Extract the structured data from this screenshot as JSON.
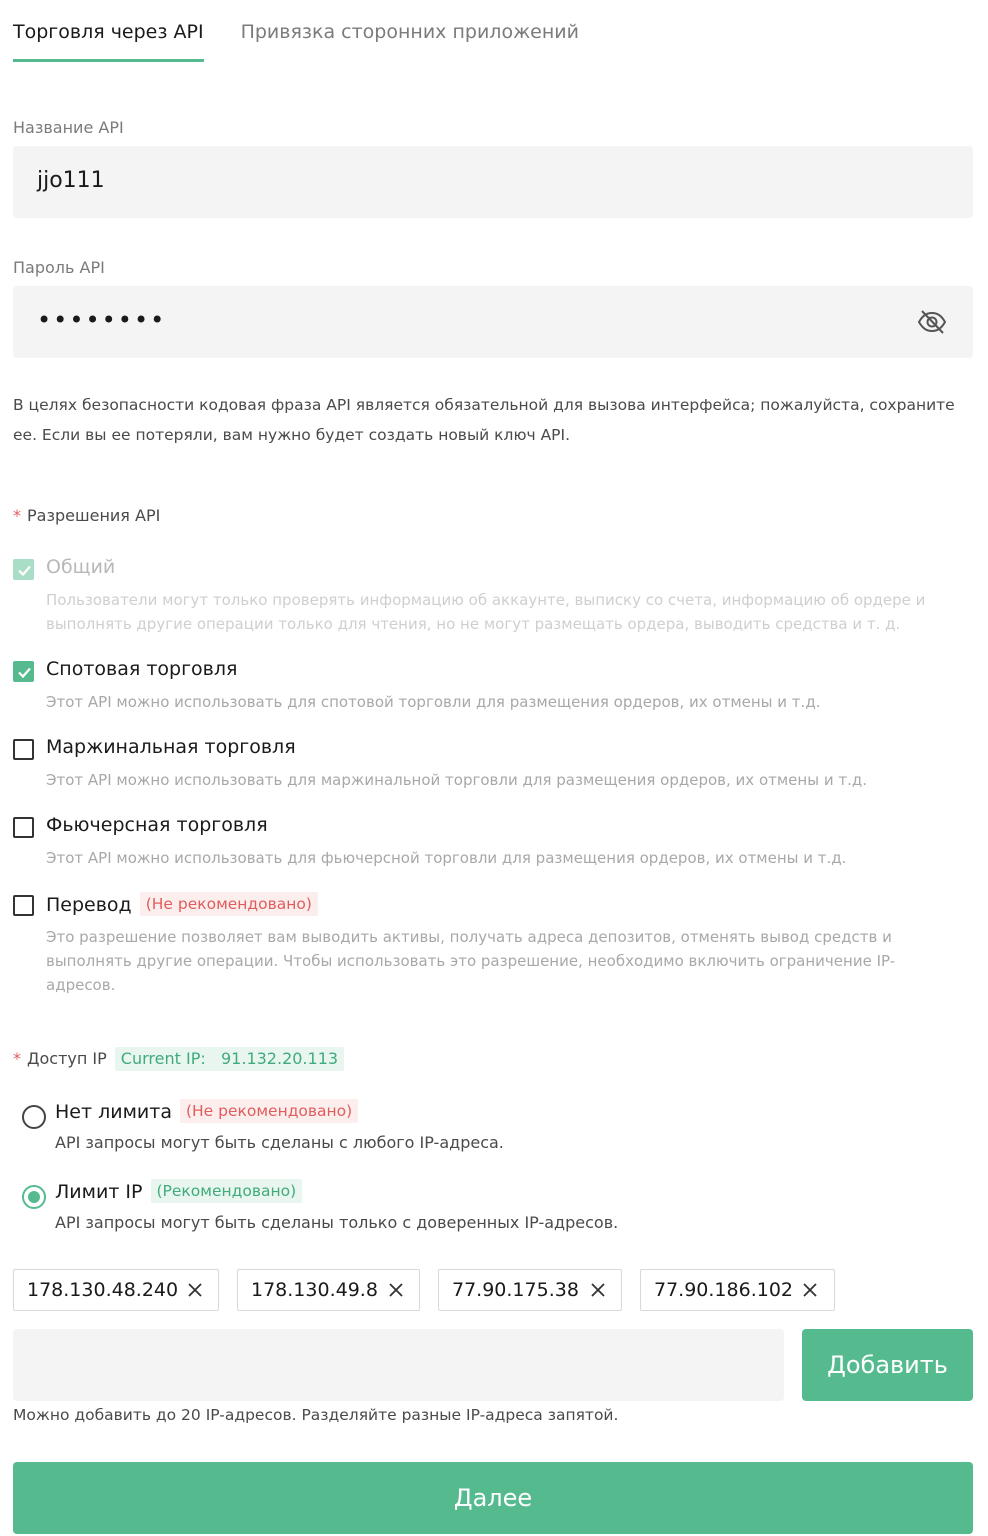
{
  "tabs": [
    {
      "label": "Торговля через API",
      "active": true
    },
    {
      "label": "Привязка сторонних приложений",
      "active": false
    }
  ],
  "api_name": {
    "label": "Название API",
    "value": "jjo111"
  },
  "api_password": {
    "label": "Пароль API",
    "masked_value": "••••••••",
    "toggle_icon": "eye-off-icon"
  },
  "security_note": "В целях безопасности кодовая фраза API является обязательной для вызова интерфейса; пожалуйста, сохраните ее. Если вы ее потеряли, вам нужно будет создать новый ключ API.",
  "permissions": {
    "required_mark": "*",
    "title": "Разрешения API",
    "items": [
      {
        "title": "Общий",
        "desc": "Пользователи могут только проверять информацию об аккаунте, выписку со счета, информацию об ордере и выполнять другие операции только для чтения, но не могут размещать ордера, выводить средства и т. д.",
        "checked": true,
        "disabled": true
      },
      {
        "title": "Спотовая торговля",
        "desc": "Этот API можно использовать для спотовой торговли для размещения ордеров, их отмены и т.д.",
        "checked": true,
        "disabled": false
      },
      {
        "title": "Маржинальная торговля",
        "desc": "Этот API можно использовать для маржинальной торговли для размещения ордеров, их отмены и т.д.",
        "checked": false,
        "disabled": false
      },
      {
        "title": "Фьючерсная торговля",
        "desc": "Этот API можно использовать для фьючерсной торговли для размещения ордеров, их отмены и т.д.",
        "checked": false,
        "disabled": false
      },
      {
        "title": "Перевод",
        "badge": "(Не рекомендовано)",
        "desc": "Это разрешение позволяет вам выводить активы, получать адреса депозитов, отменять вывод средств и выполнять другие операции. Чтобы использовать это разрешение, необходимо включить ограничение IP-адресов.",
        "checked": false,
        "disabled": false
      }
    ]
  },
  "ip_access": {
    "required_mark": "*",
    "title": "Доступ IP",
    "current_ip_label": "Current IP:",
    "current_ip": "91.132.20.113",
    "options": [
      {
        "title": "Нет лимита",
        "badge": "(Не рекомендовано)",
        "desc": "API запросы могут быть сделаны с любого IP-адреса.",
        "selected": false
      },
      {
        "title": "Лимит IP",
        "badge": "(Рекомендовано)",
        "desc": "API запросы могут быть сделаны только с доверенных IP-адресов.",
        "selected": true
      }
    ],
    "ips": [
      "178.130.48.240",
      "178.130.49.8",
      "77.90.175.38",
      "77.90.186.102"
    ],
    "input_value": "",
    "add_label": "Добавить",
    "hint": "Можно добавить до 20 IP-адресов. Разделяйте разные IP-адреса запятой."
  },
  "next_label": "Далее",
  "colors": {
    "accent": "#55bb8f",
    "warning": "#e05d5d"
  }
}
